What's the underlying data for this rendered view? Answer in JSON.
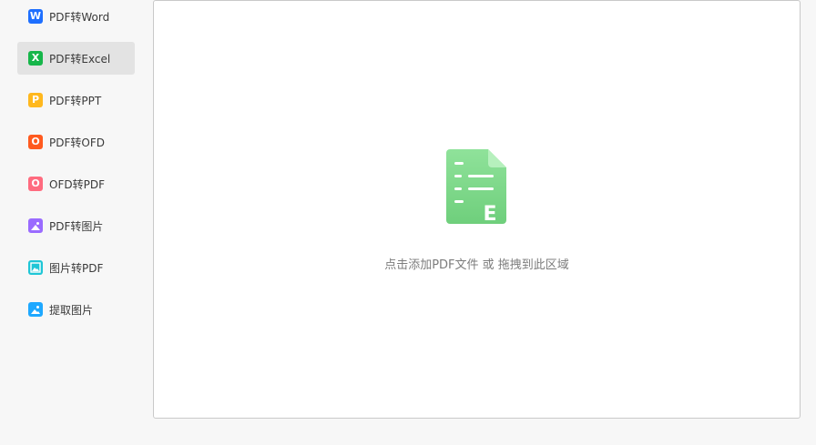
{
  "sidebar": {
    "items": [
      {
        "label": "PDF转Word",
        "icon": "word-icon",
        "color": "#1e6fff",
        "glyph": "W",
        "active": false
      },
      {
        "label": "PDF转Excel",
        "icon": "excel-icon",
        "color": "#16b64a",
        "glyph": "X",
        "active": true
      },
      {
        "label": "PDF转PPT",
        "icon": "ppt-icon",
        "color": "#ffb81e",
        "glyph": "P",
        "active": false
      },
      {
        "label": "PDF转OFD",
        "icon": "ofd-icon",
        "color": "#ff5a1f",
        "glyph": "O",
        "active": false
      },
      {
        "label": "OFD转PDF",
        "icon": "ofd-to-pdf-icon",
        "color": "#ff6b7f",
        "glyph": "O",
        "active": false
      },
      {
        "label": "PDF转图片",
        "icon": "pdf-to-image-icon",
        "color": "#9a6bff",
        "glyph": "",
        "active": false
      },
      {
        "label": "图片转PDF",
        "icon": "image-to-pdf-icon",
        "color": "#1fc6d6",
        "glyph": "",
        "active": false
      },
      {
        "label": "提取图片",
        "icon": "extract-image-icon",
        "color": "#1ea8ff",
        "glyph": "",
        "active": false
      }
    ]
  },
  "dropzone": {
    "hint": "点击添加PDF文件 或 拖拽到此区域",
    "icon": "excel-file-icon",
    "icon_color": "#7ed88a",
    "icon_glyph": "E"
  }
}
